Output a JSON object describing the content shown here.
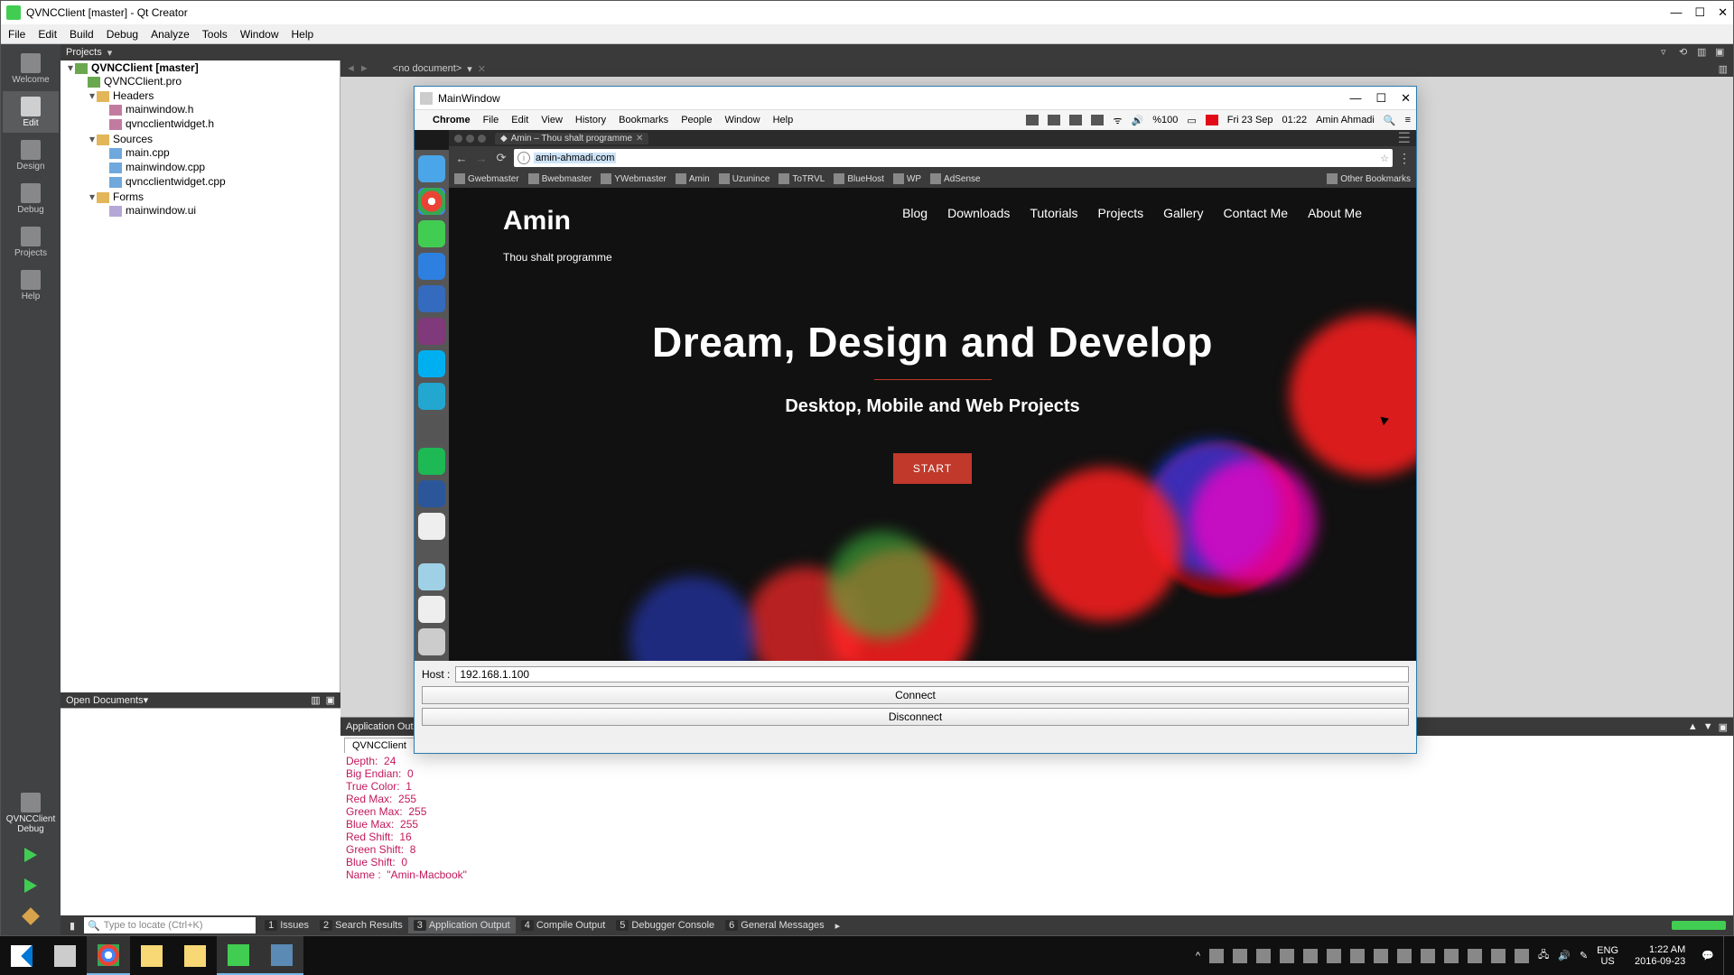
{
  "qtc": {
    "title": "QVNCClient [master] - Qt Creator",
    "menus": [
      "File",
      "Edit",
      "Build",
      "Debug",
      "Analyze",
      "Tools",
      "Window",
      "Help"
    ],
    "modes": [
      {
        "label": "Welcome"
      },
      {
        "label": "Edit"
      },
      {
        "label": "Design"
      },
      {
        "label": "Debug"
      },
      {
        "label": "Projects"
      },
      {
        "label": "Help"
      }
    ],
    "active_mode": 1,
    "kit": {
      "name": "QVNCClient",
      "config": "Debug"
    },
    "projects_label": "Projects",
    "doc_combo": "<no document>",
    "tree": {
      "root": "QVNCClient [master]",
      "pro": "QVNCClient.pro",
      "headers": "Headers",
      "header_files": [
        "mainwindow.h",
        "qvncclientwidget.h"
      ],
      "sources": "Sources",
      "source_files": [
        "main.cpp",
        "mainwindow.cpp",
        "qvncclientwidget.cpp"
      ],
      "forms": "Forms",
      "form_files": [
        "mainwindow.ui"
      ]
    },
    "open_docs": "Open Documents",
    "outpane": {
      "title": "Application Output",
      "tab": "QVNCClient",
      "lines": [
        "Depth:  24",
        "Big Endian:  0",
        "True Color:  1",
        "Red Max:  255",
        "Green Max:  255",
        "Blue Max:  255",
        "Red Shift:  16",
        "Green Shift:  8",
        "Blue Shift:  0",
        "Name :  \"Amin-Macbook\""
      ]
    },
    "status": {
      "locator_placeholder": "Type to locate (Ctrl+K)",
      "items": [
        {
          "n": "1",
          "l": "Issues"
        },
        {
          "n": "2",
          "l": "Search Results"
        },
        {
          "n": "3",
          "l": "Application Output"
        },
        {
          "n": "4",
          "l": "Compile Output"
        },
        {
          "n": "5",
          "l": "Debugger Console"
        },
        {
          "n": "6",
          "l": "General Messages"
        }
      ],
      "active": 2
    }
  },
  "vnc": {
    "title": "MainWindow",
    "host_label": "Host :",
    "host_value": "192.168.1.100",
    "connect": "Connect",
    "disconnect": "Disconnect"
  },
  "mac": {
    "app": "Chrome",
    "menus": [
      "File",
      "Edit",
      "View",
      "History",
      "Bookmarks",
      "People",
      "Window",
      "Help"
    ],
    "battery": "%100",
    "date": "Fri 23 Sep",
    "time": "01:22",
    "user": "Amin Ahmadi"
  },
  "chrome": {
    "tab": "Amin – Thou shalt programme",
    "url": "amin-ahmadi.com",
    "bookmarks": [
      "Gwebmaster",
      "Bwebmaster",
      "YWebmaster",
      "Amin",
      "Uzunince",
      "ToTRVL",
      "BlueHost",
      "WP",
      "AdSense"
    ],
    "other": "Other Bookmarks"
  },
  "page": {
    "site_title": "Amin",
    "site_sub": "Thou shalt programme",
    "nav": [
      "Blog",
      "Downloads",
      "Tutorials",
      "Projects",
      "Gallery",
      "Contact Me",
      "About Me"
    ],
    "hero_h1": "Dream, Design and Develop",
    "hero_h2": "Desktop, Mobile and Web Projects",
    "start": "START"
  },
  "taskbar": {
    "lang": "ENG",
    "locale": "US",
    "time": "1:22 AM",
    "date": "2016-09-23"
  }
}
